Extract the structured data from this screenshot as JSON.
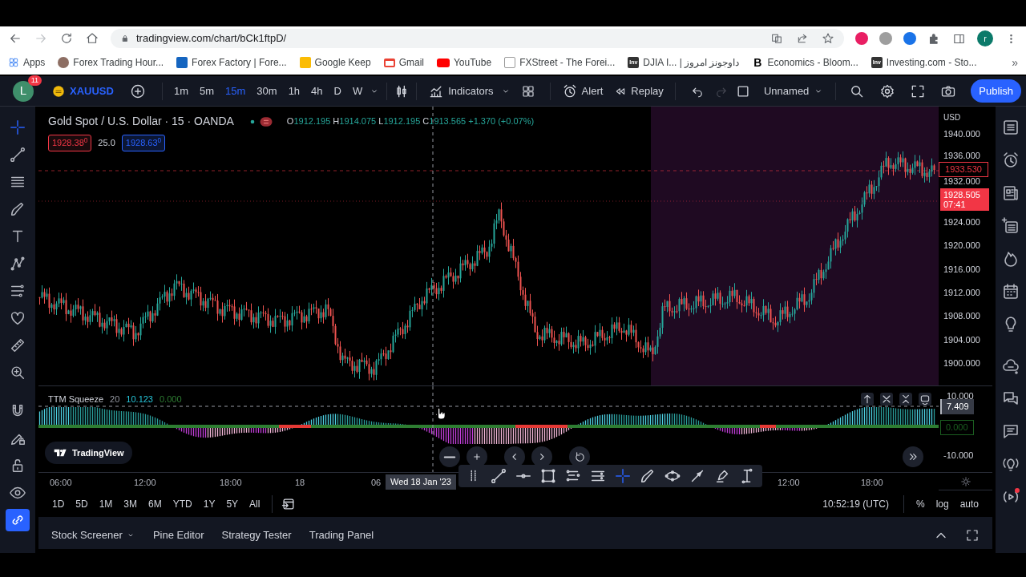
{
  "browser": {
    "url": "tradingview.com/chart/bCk1ftpD/",
    "profile_initial": "r",
    "more": "»",
    "bookmarks": [
      {
        "kind": "apps",
        "label": "Apps"
      },
      {
        "kind": "clock",
        "label": "Forex Trading Hour..."
      },
      {
        "kind": "flag",
        "label": "Forex Factory | Fore..."
      },
      {
        "kind": "keep",
        "label": "Google Keep"
      },
      {
        "kind": "gmail",
        "label": "Gmail"
      },
      {
        "kind": "youtube",
        "label": "YouTube"
      },
      {
        "kind": "fxs",
        "label": "FXStreet - The Forei..."
      },
      {
        "kind": "inv",
        "icon_text": "Inv",
        "label": "DJIA I... | داوجونز امروز"
      },
      {
        "kind": "letter",
        "icon_text": "B",
        "label": "Economics - Bloom..."
      },
      {
        "kind": "inv",
        "icon_text": "Inv",
        "label": "Investing.com - Sto..."
      }
    ]
  },
  "toolbar": {
    "avatar": "L",
    "notifications": "11",
    "symbol": "XAUUSD",
    "intervals": [
      {
        "label": "1m",
        "selected": false
      },
      {
        "label": "5m",
        "selected": false
      },
      {
        "label": "15m",
        "selected": true
      },
      {
        "label": "30m",
        "selected": false
      },
      {
        "label": "1h",
        "selected": false
      },
      {
        "label": "4h",
        "selected": false
      },
      {
        "label": "D",
        "selected": false
      },
      {
        "label": "W",
        "selected": false
      }
    ],
    "indicators": "Indicators",
    "alert": "Alert",
    "replay": "Replay",
    "redo_disabled": true,
    "layout": "Unnamed",
    "publish": "Publish"
  },
  "left_tools": [
    {
      "kind": "crosshair",
      "selected": true
    },
    {
      "kind": "trendline",
      "selected": false
    },
    {
      "kind": "fib",
      "selected": false
    },
    {
      "kind": "brush",
      "selected": false
    },
    {
      "kind": "text",
      "selected": false
    },
    {
      "kind": "pattern",
      "selected": false
    },
    {
      "kind": "forecast",
      "selected": false
    },
    {
      "kind": "heart",
      "selected": false
    },
    {
      "kind": "ruler",
      "selected": false
    },
    {
      "kind": "zoom",
      "selected": false
    },
    {
      "kind": "magnet",
      "selected": false
    },
    {
      "kind": "pencil-lock",
      "selected": false
    },
    {
      "kind": "lock",
      "selected": false
    },
    {
      "kind": "eye",
      "selected": false
    },
    {
      "kind": "link",
      "selected": false,
      "on": true
    }
  ],
  "chart": {
    "title": "Gold Spot / U.S. Dollar · 15 · OANDA",
    "ohlc": [
      {
        "key": "O",
        "value": "1912.195"
      },
      {
        "key": "H",
        "value": "1914.075"
      },
      {
        "key": "L",
        "value": "1912.195"
      },
      {
        "key": "C",
        "value": "1913.565"
      }
    ],
    "change": "+1.370 (+0.07%)",
    "sell": "1928.38$^{0}$",
    "spread": "25.0",
    "buy": "1928.63$^{0}$",
    "currency": "USD",
    "price_ticks": [
      "1940.000",
      "1936.000",
      "1932.000",
      "1924.000",
      "1920.000",
      "1916.000",
      "1912.000",
      "1908.000",
      "1904.000",
      "1900.000"
    ],
    "alert_price": "1933.530",
    "last_price": "1928.505",
    "countdown": "07:41",
    "logo": "TradingView"
  },
  "indicator": {
    "name": "TTM Squeeze",
    "length": "20",
    "value": "10.123",
    "value_2": "0.000",
    "ticks": [
      "10.000",
      "-10.000"
    ],
    "current": "7.409",
    "zero": "0.000"
  },
  "time_axis": {
    "labels": [
      "06:00",
      "12:00",
      "18:00",
      "18",
      "06",
      "12:00",
      "18:00"
    ],
    "crosshair_date": "Wed 18 Jan '23"
  },
  "ranges": [
    "1D",
    "5D",
    "1M",
    "3M",
    "6M",
    "YTD",
    "1Y",
    "5Y",
    "All"
  ],
  "clock": "10:52:19 (UTC)",
  "scale_options": [
    "%",
    "log",
    "auto"
  ],
  "bottom_tabs": [
    {
      "label": "Stock Screener",
      "dropdown": true
    },
    {
      "label": "Pine Editor",
      "dropdown": false
    },
    {
      "label": "Strategy Tester",
      "dropdown": false
    },
    {
      "label": "Trading Panel",
      "dropdown": false
    }
  ]
}
